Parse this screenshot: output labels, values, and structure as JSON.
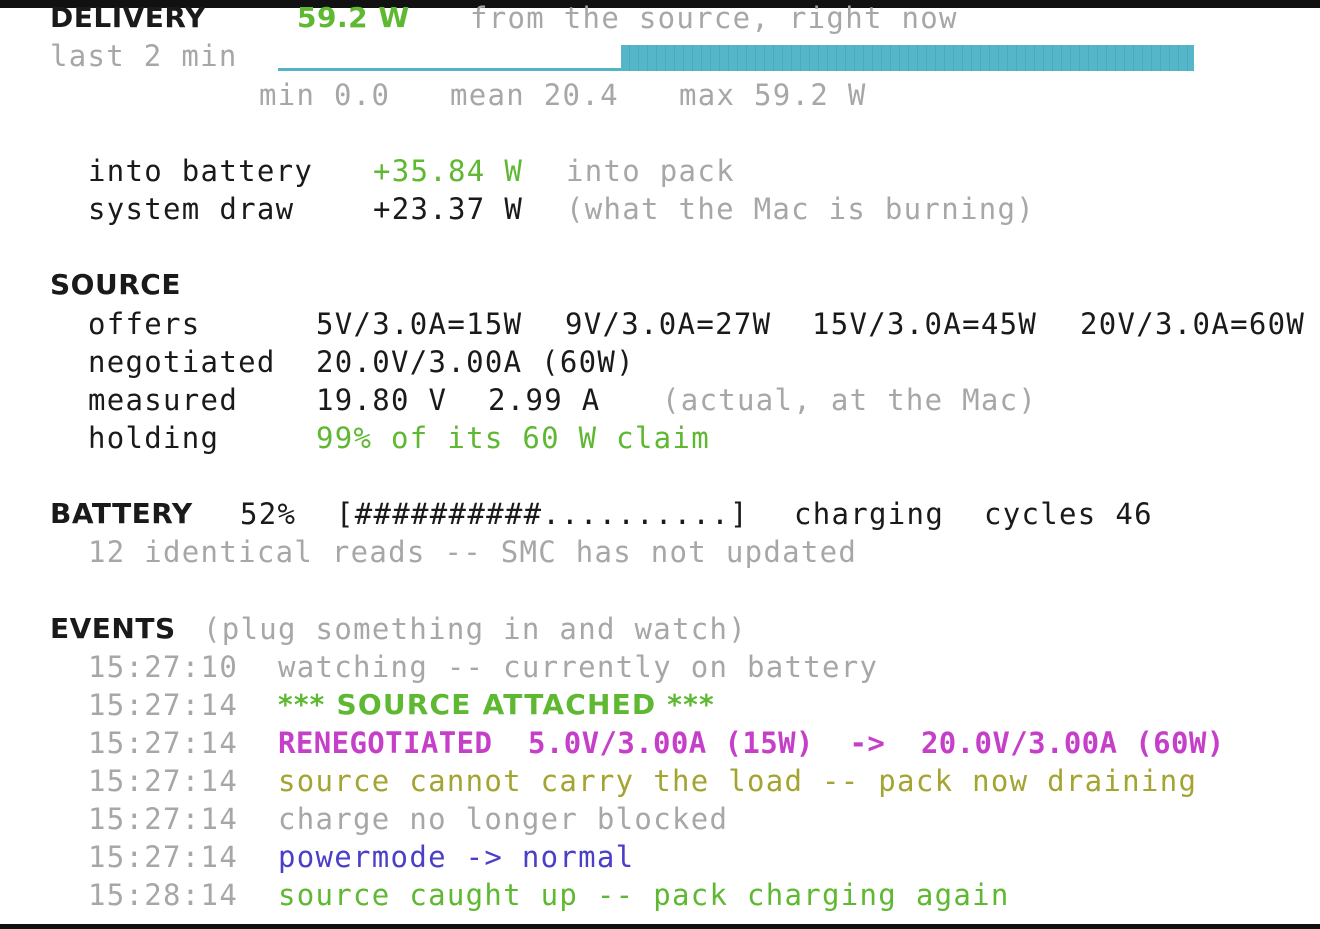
{
  "delivery": {
    "heading": "DELIVERY",
    "watts": "59.2 W",
    "caption": "from the source, right now",
    "window": "last 2 min",
    "stats": {
      "min": "min 0.0",
      "mean": "mean 20.4",
      "max": "max 59.2 W"
    },
    "sparkline": {
      "low_value": 0.0,
      "high_value": 59.2,
      "low_fraction": 0.374,
      "color": "#54b6c8"
    },
    "into_battery": {
      "label": "into battery",
      "value": "+35.84 W",
      "note": "into pack"
    },
    "system_draw": {
      "label": "system draw",
      "value": "+23.37 W",
      "note": "(what the Mac is burning)"
    }
  },
  "source": {
    "heading": "SOURCE",
    "offers_label": "offers",
    "offers": [
      "5V/3.0A=15W",
      "9V/3.0A=27W",
      "15V/3.0A=45W",
      "20V/3.0A=60W"
    ],
    "negotiated_label": "negotiated",
    "negotiated": "20.0V/3.00A (60W)",
    "measured_label": "measured",
    "measured_volts": "19.80 V",
    "measured_amps": "2.99 A",
    "measured_note": "(actual, at the Mac)",
    "holding_label": "holding",
    "holding": "99% of its 60 W claim"
  },
  "battery": {
    "heading": "BATTERY",
    "percent": "52%",
    "bar": "[##########..........]",
    "state": "charging",
    "cycles": "cycles 46",
    "note": "12 identical reads -- SMC has not updated"
  },
  "events": {
    "heading": "EVENTS",
    "hint": "(plug something in and watch)",
    "items": [
      {
        "time": "15:27:10",
        "text": "watching -- currently on battery"
      },
      {
        "time": "15:27:14",
        "text": "*** SOURCE ATTACHED ***"
      },
      {
        "time": "15:27:14",
        "text": "RENEGOTIATED  5.0V/3.00A (15W)  ->  20.0V/3.00A (60W)"
      },
      {
        "time": "15:27:14",
        "text": "source cannot carry the load -- pack now draining"
      },
      {
        "time": "15:27:14",
        "text": "charge no longer blocked"
      },
      {
        "time": "15:27:14",
        "text": "powermode -> normal"
      },
      {
        "time": "15:28:14",
        "text": "source caught up -- pack charging again"
      }
    ]
  },
  "colors": {
    "green": "#5fb832",
    "magenta": "#c63fc9",
    "olive": "#a3a431",
    "blue": "#4a3fc8",
    "dim": "#a7a7a7",
    "sparkline": "#54b6c8"
  }
}
